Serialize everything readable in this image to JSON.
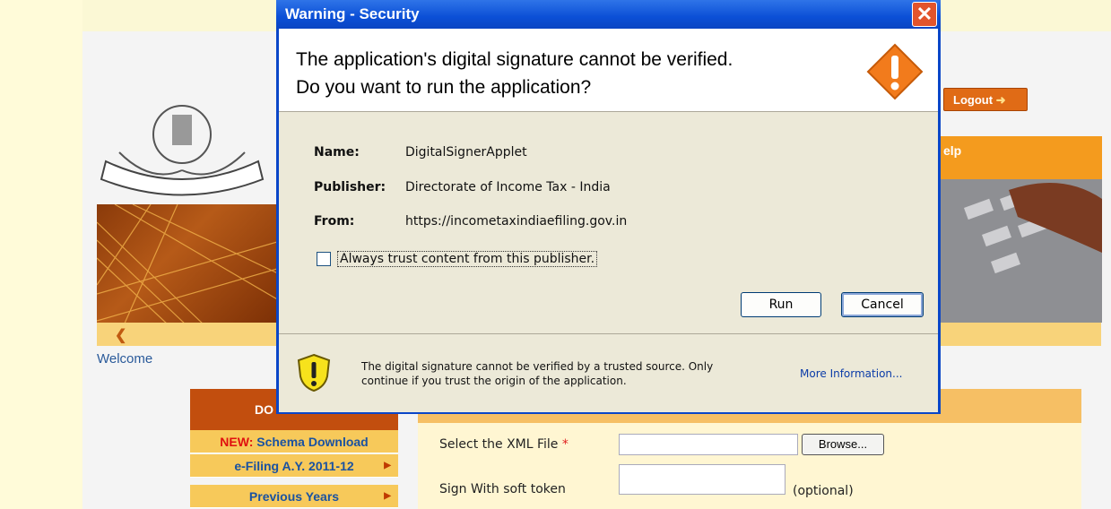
{
  "background_page": {
    "logout_label": "Logout",
    "help_label": "elp",
    "welcome_text": "Welcome",
    "nav": {
      "header": "DO",
      "items": [
        {
          "prefix": "NEW:",
          "label": "Schema Download"
        },
        {
          "prefix": "",
          "label": "e-Filing A.Y. 2011-12"
        },
        {
          "prefix": "",
          "label": "Previous Years"
        }
      ]
    },
    "form": {
      "xml_file_label": "Select the XML File",
      "required_marker": "*",
      "browse_label": "Browse...",
      "soft_token_label": "Sign With soft token",
      "optional_text": "(optional)"
    },
    "colors": {
      "accent": "#c24e0e",
      "link": "#1a52a1"
    }
  },
  "dialog": {
    "title": "Warning - Security",
    "headline_line1": "The application's digital signature cannot be verified.",
    "headline_line2": "Do you want to run the application?",
    "fields": [
      {
        "key": "Name:",
        "value": "DigitalSignerApplet"
      },
      {
        "key": "Publisher:",
        "value": "Directorate of Income Tax - India"
      },
      {
        "key": "From:",
        "value": "https://incometaxindiaefiling.gov.in"
      }
    ],
    "trust_checkbox_label": "Always trust content from this publisher.",
    "trust_checked": false,
    "run_label": "Run",
    "cancel_label": "Cancel",
    "footer_line1": "The digital signature cannot be verified by a trusted source.  Only",
    "footer_line2": "continue if you trust the origin of the application.",
    "more_info_label": "More Information...",
    "icons": {
      "warning": "warning-diamond-icon",
      "shield": "shield-warning-icon",
      "close": "close-icon"
    },
    "colors": {
      "titlebar": "#0b4fd6",
      "warning": "#f27b1c",
      "close": "#e2542c"
    }
  }
}
